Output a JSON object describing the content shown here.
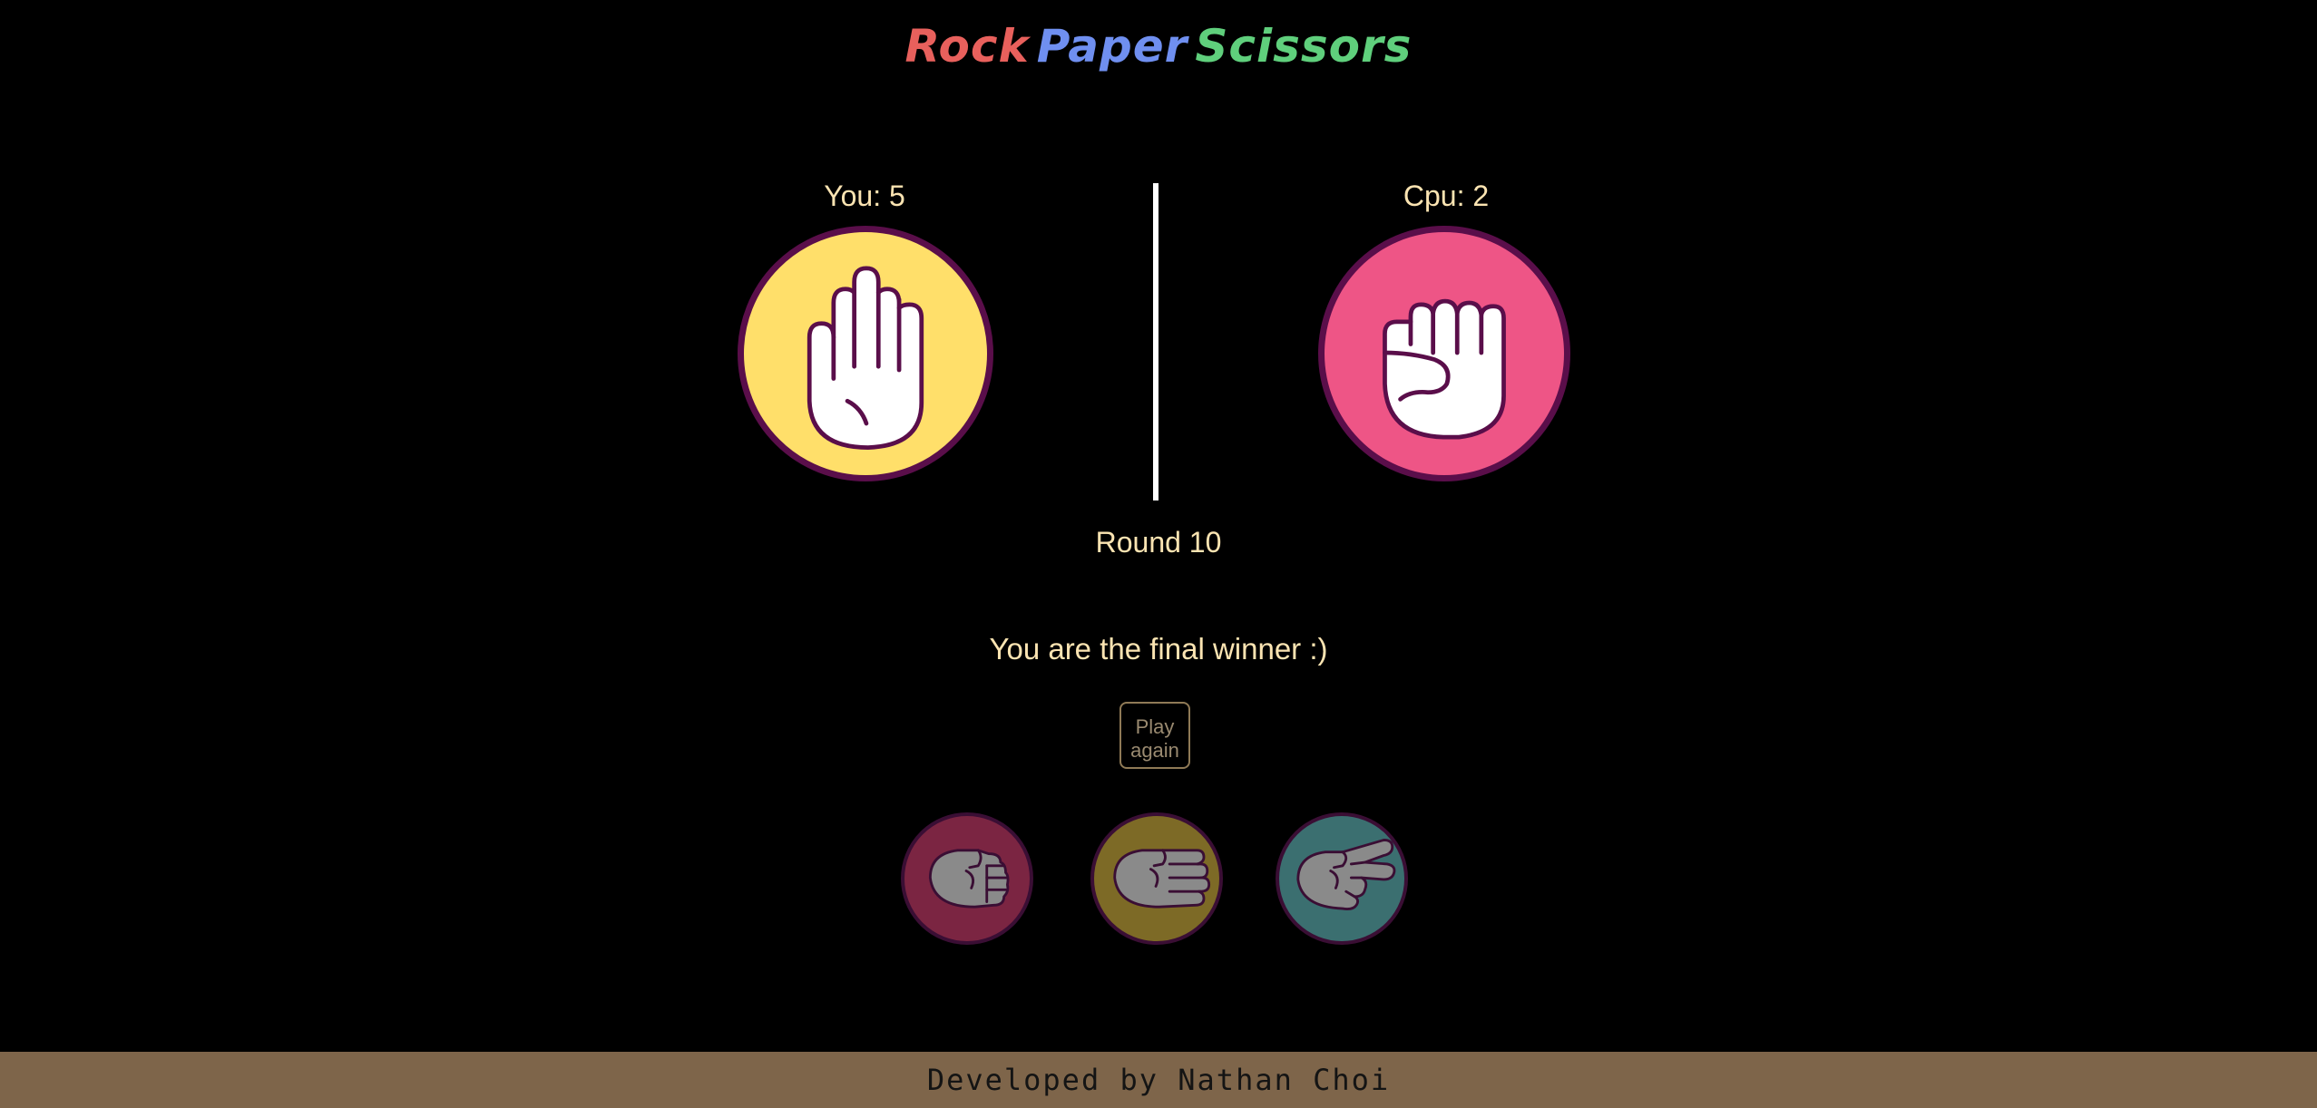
{
  "header": {
    "title_words": [
      "Rock",
      "Paper",
      "Scissors"
    ],
    "title_colors": [
      "#e8605c",
      "#6f8ff0",
      "#5fcf7c"
    ]
  },
  "scoreboard": {
    "you_label": "You: 5",
    "cpu_label": "Cpu: 2"
  },
  "player_hand": {
    "icon": "paper-hand-icon",
    "color": "#ffdf6a"
  },
  "cpu_hand": {
    "icon": "rock-hand-icon",
    "color": "#ee5586"
  },
  "round_text": "Round 10",
  "result_text": "You are the final winner :)",
  "play_again_label": "Play again",
  "choices": [
    {
      "name": "rock",
      "icon": "rock-hand-icon",
      "color": "#7b2542"
    },
    {
      "name": "paper",
      "icon": "paper-hand-icon",
      "color": "#7d6a26"
    },
    {
      "name": "scissors",
      "icon": "scissors-hand-icon",
      "color": "#3b6f70"
    }
  ],
  "footer_text": "Developed by Nathan Choi"
}
